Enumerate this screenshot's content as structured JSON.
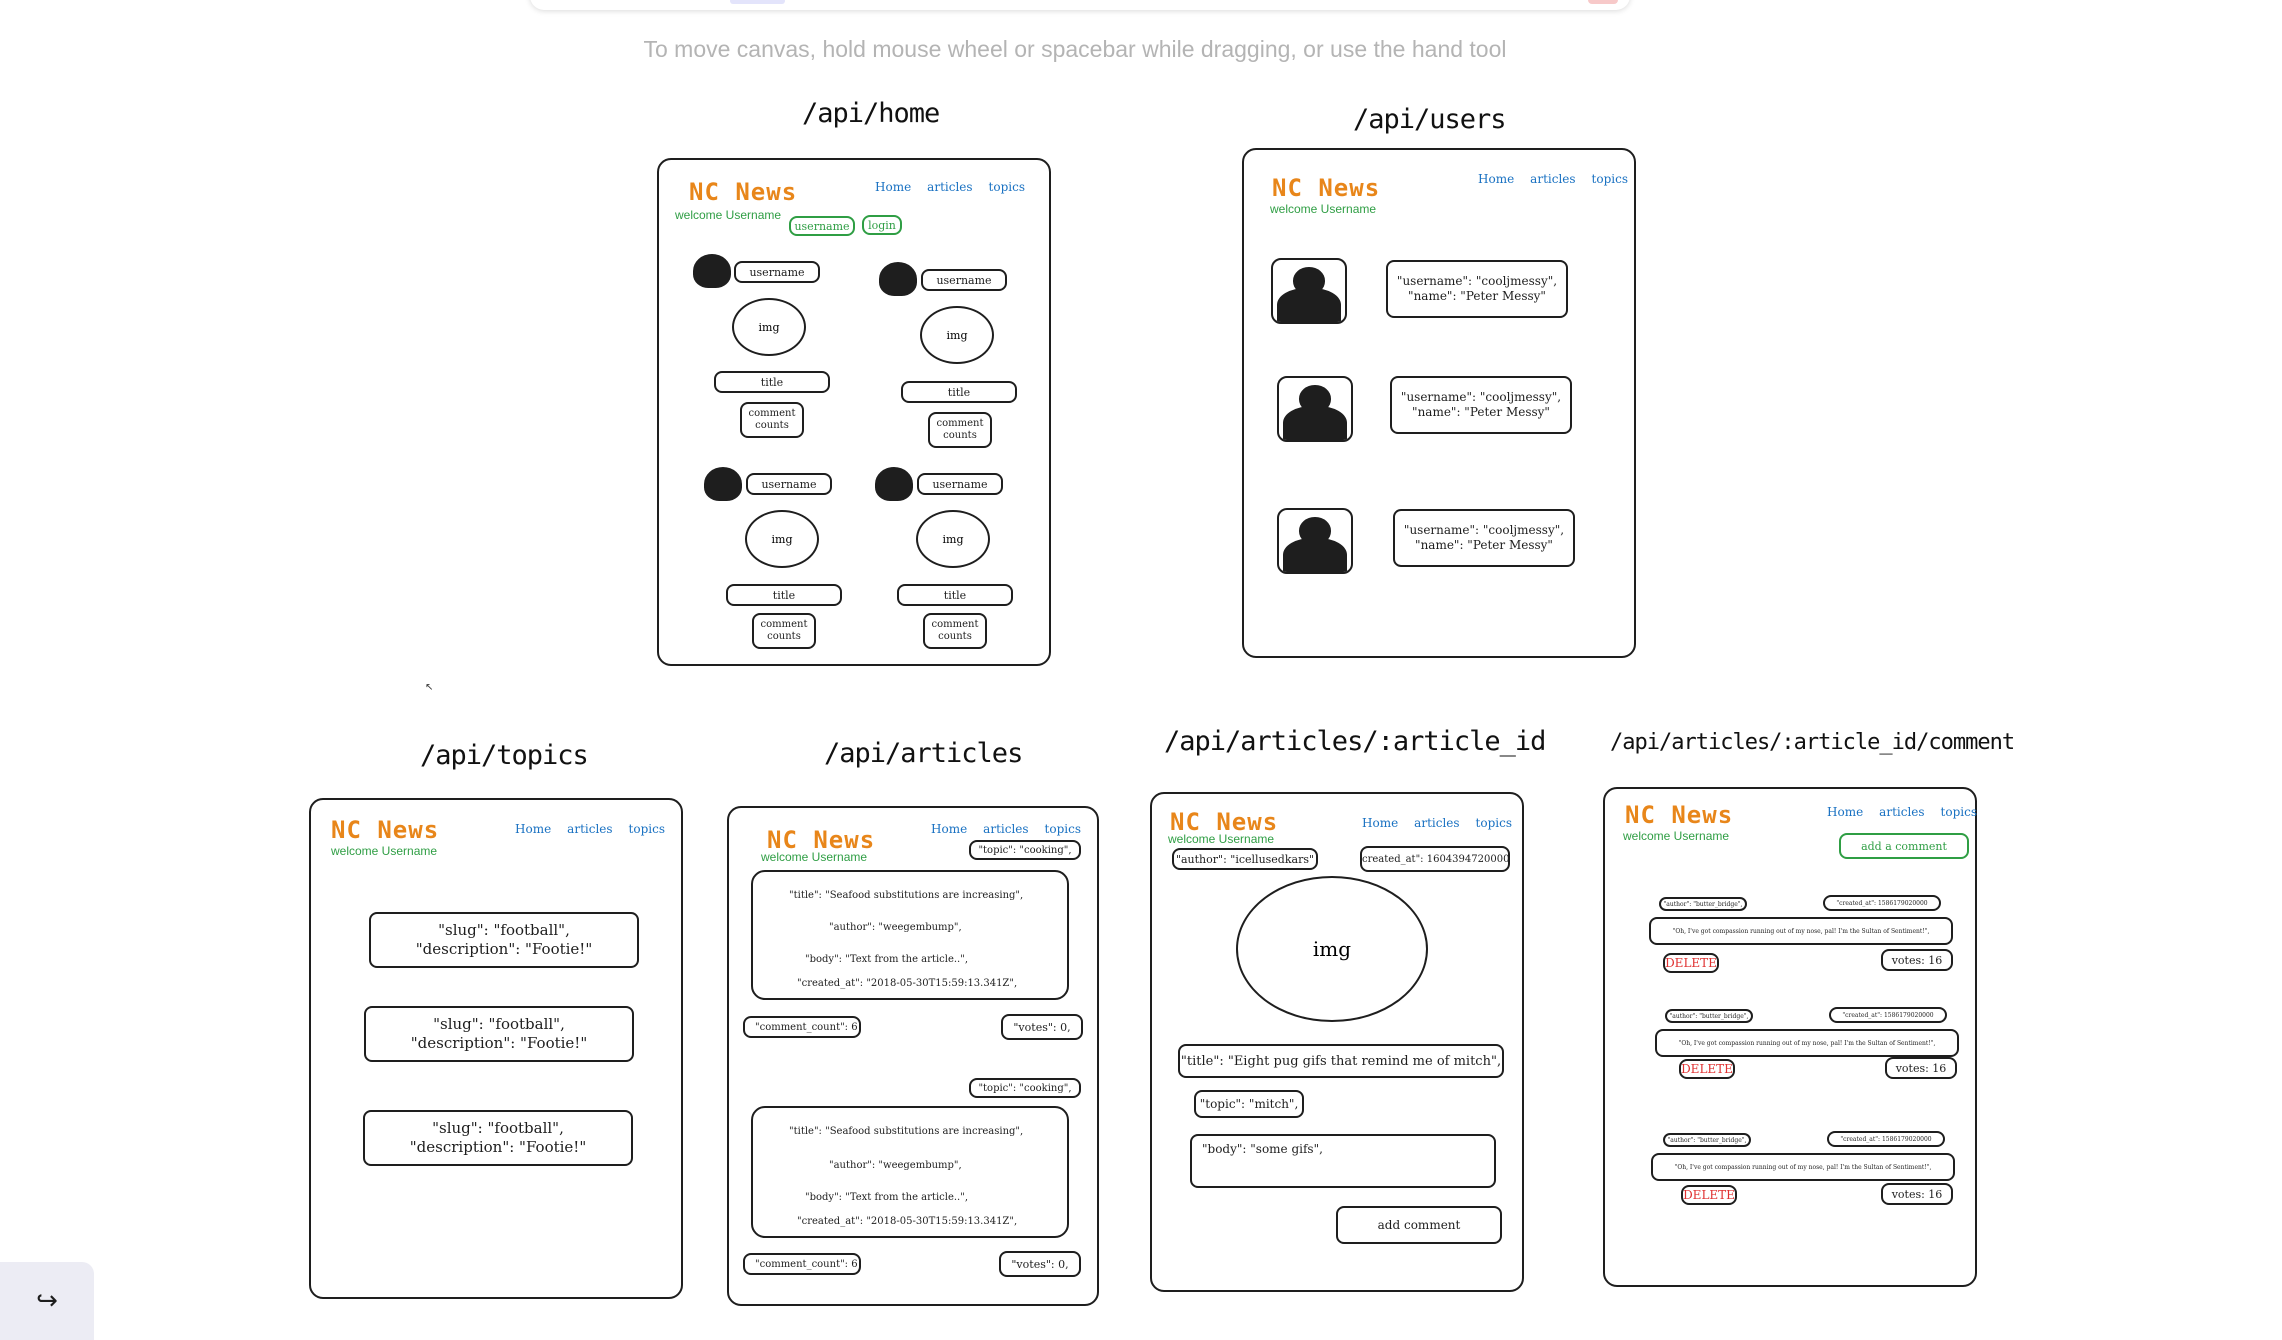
{
  "hint": "To move canvas, hold mouse wheel or spacebar while dragging, or use the hand tool",
  "common": {
    "logo": "NC News",
    "welcome": "welcome Username",
    "nav": [
      "Home",
      "articles",
      "topics"
    ]
  },
  "home": {
    "title": "/api/home",
    "username_input": "username",
    "login_button": "login",
    "cards": [
      {
        "username": "username",
        "img": "img",
        "title": "title",
        "comments": "comment counts"
      },
      {
        "username": "username",
        "img": "img",
        "title": "title",
        "comments": "comment counts"
      },
      {
        "username": "username",
        "img": "img",
        "title": "title",
        "comments": "comment counts"
      },
      {
        "username": "username",
        "img": "img",
        "title": "title",
        "comments": "comment counts"
      }
    ]
  },
  "users": {
    "title": "/api/users",
    "rows": [
      {
        "username": "\"username\": \"cooljmessy\",",
        "name": "\"name\": \"Peter Messy\""
      },
      {
        "username": "\"username\": \"cooljmessy\",",
        "name": "\"name\": \"Peter Messy\""
      },
      {
        "username": "\"username\": \"cooljmessy\",",
        "name": "\"name\": \"Peter Messy\""
      }
    ]
  },
  "topics": {
    "title": "/api/topics",
    "rows": [
      {
        "slug": "\"slug\": \"football\",",
        "description": "\"description\": \"Footie!\""
      },
      {
        "slug": "\"slug\": \"football\",",
        "description": "\"description\": \"Footie!\""
      },
      {
        "slug": "\"slug\": \"football\",",
        "description": "\"description\": \"Footie!\""
      }
    ]
  },
  "articles": {
    "title": "/api/articles",
    "items": [
      {
        "topic": "\"topic\": \"cooking\",",
        "title": "\"title\": \"Seafood substitutions are increasing\",",
        "author": "\"author\": \"weegembump\",",
        "body": "\"body\": \"Text from the article..\",",
        "created_at": "\"created_at\": \"2018-05-30T15:59:13.341Z\",",
        "comment_count": "\"comment_count\": 6",
        "votes": "\"votes\": 0,"
      },
      {
        "topic": "\"topic\": \"cooking\",",
        "title": "\"title\": \"Seafood substitutions are increasing\",",
        "author": "\"author\": \"weegembump\",",
        "body": "\"body\": \"Text from the article..\",",
        "created_at": "\"created_at\": \"2018-05-30T15:59:13.341Z\",",
        "comment_count": "\"comment_count\": 6",
        "votes": "\"votes\": 0,"
      }
    ]
  },
  "article": {
    "title": "/api/articles/:article_id",
    "author": "\"author\": \"icellusedkars\"",
    "created_at": "\"created_at\": 1604394720000,",
    "img": "img",
    "article_title": "\"title\": \"Eight pug gifs that remind me of mitch\",",
    "topic": "\"topic\": \"mitch\",",
    "body": "\"body\": \"some gifs\",",
    "add_comment": "add comment"
  },
  "comments": {
    "title": "/api/articles/:article_id/comment",
    "add_comment": "add a comment",
    "items": [
      {
        "author": "\"author\": \"butter_bridge\",",
        "created_at": "\"created_at\": 1586179020000",
        "body": "\"Oh, I've got compassion running out of my nose, pal! I'm the Sultan of Sentiment!\",",
        "delete": "DELETE",
        "votes": "votes: 16"
      },
      {
        "author": "\"author\": \"butter_bridge\",",
        "created_at": "\"created_at\": 1586179020000",
        "body": "\"Oh, I've got compassion running out of my nose, pal! I'm the Sultan of Sentiment!\",",
        "delete": "DELETE",
        "votes": "votes: 16"
      },
      {
        "author": "\"author\": \"butter_bridge\",",
        "created_at": "\"created_at\": 1586179020000",
        "body": "\"Oh, I've got compassion running out of my nose, pal! I'm the Sultan of Sentiment!\",",
        "delete": "DELETE",
        "votes": "votes: 16"
      }
    ]
  },
  "share_icon": "share-arrow-icon"
}
